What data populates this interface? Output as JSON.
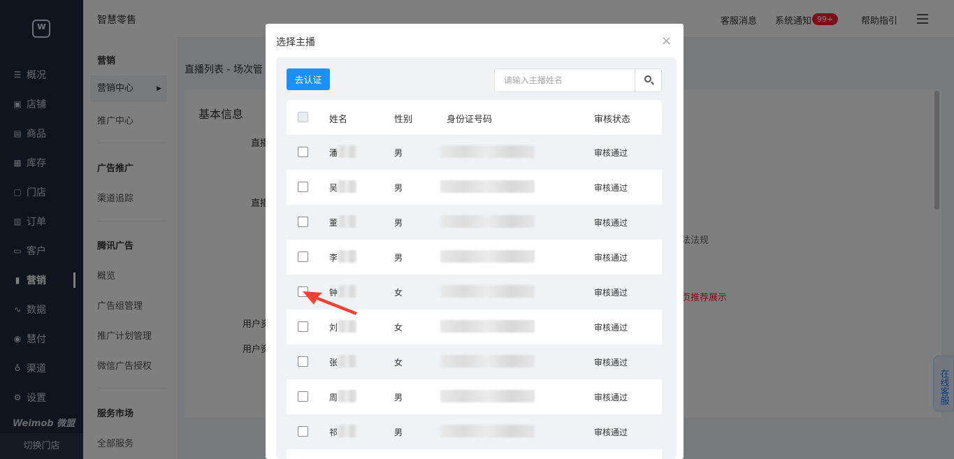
{
  "app": {
    "title": "智慧零售"
  },
  "nav": {
    "items": [
      {
        "label": "概况",
        "icon": "dashboard-icon",
        "glyph": "☰"
      },
      {
        "label": "店铺",
        "icon": "store-icon",
        "glyph": "▣"
      },
      {
        "label": "商品",
        "icon": "goods-icon",
        "glyph": "▤"
      },
      {
        "label": "库存",
        "icon": "inventory-icon",
        "glyph": "▦"
      },
      {
        "label": "门店",
        "icon": "shop-icon",
        "glyph": "▢"
      },
      {
        "label": "订单",
        "icon": "order-icon",
        "glyph": "▥"
      },
      {
        "label": "客户",
        "icon": "customer-icon",
        "glyph": "▭"
      },
      {
        "label": "营销",
        "icon": "marketing-icon",
        "glyph": "▮"
      },
      {
        "label": "数据",
        "icon": "data-icon",
        "glyph": "∿"
      },
      {
        "label": "慧付",
        "icon": "pay-icon",
        "glyph": "◉"
      },
      {
        "label": "渠道",
        "icon": "channel-icon",
        "glyph": "♁"
      },
      {
        "label": "设置",
        "icon": "settings-icon",
        "glyph": "⚙"
      }
    ],
    "active": "营销",
    "brand": "Weimob 微盟",
    "switch_store": "切换门店"
  },
  "submenu": {
    "groups": [
      {
        "title": "营销",
        "items": [
          "营销中心",
          "推广中心"
        ]
      },
      {
        "title": "广告推广",
        "items": [
          "渠道追踪"
        ]
      },
      {
        "title": "腾讯广告",
        "items": [
          "概览",
          "广告组管理",
          "推广计划管理",
          "微信广告授权"
        ]
      },
      {
        "title": "服务市场",
        "items": [
          "全部服务"
        ]
      }
    ],
    "selected": "营销中心"
  },
  "header": {
    "customer_msg": "客服消息",
    "system_notice": "系统通知",
    "notice_badge": "99+",
    "help": "帮助指引"
  },
  "page": {
    "breadcrumb": "直播列表 - 场次管",
    "card_title": "基本信息",
    "labels": [
      "直播",
      "直播",
      "用户资",
      "用户资"
    ],
    "gray_text": "法法规",
    "red_text": "页推荐展示"
  },
  "online_service": "在线客服",
  "modal": {
    "title": "选择主播",
    "verify_button": "去认证",
    "search_placeholder": "请输入主播姓名",
    "columns": [
      "姓名",
      "性别",
      "身份证号码",
      "审核状态"
    ],
    "rows": [
      {
        "name": "潘",
        "gender": "男",
        "status": "审核通过"
      },
      {
        "name": "吴",
        "gender": "男",
        "status": "审核通过"
      },
      {
        "name": "董",
        "gender": "男",
        "status": "审核通过"
      },
      {
        "name": "李",
        "gender": "男",
        "status": "审核通过"
      },
      {
        "name": "钟",
        "gender": "女",
        "status": "审核通过"
      },
      {
        "name": "刘",
        "gender": "女",
        "status": "审核通过"
      },
      {
        "name": "张",
        "gender": "女",
        "status": "审核通过"
      },
      {
        "name": "周",
        "gender": "男",
        "status": "审核通过"
      },
      {
        "name": "祁",
        "gender": "男",
        "status": "审核通过"
      }
    ]
  },
  "colors": {
    "accent": "#1890ff",
    "badge": "#f5222d",
    "arrow": "#f04134",
    "nav_bg": "#1f2a3d"
  }
}
